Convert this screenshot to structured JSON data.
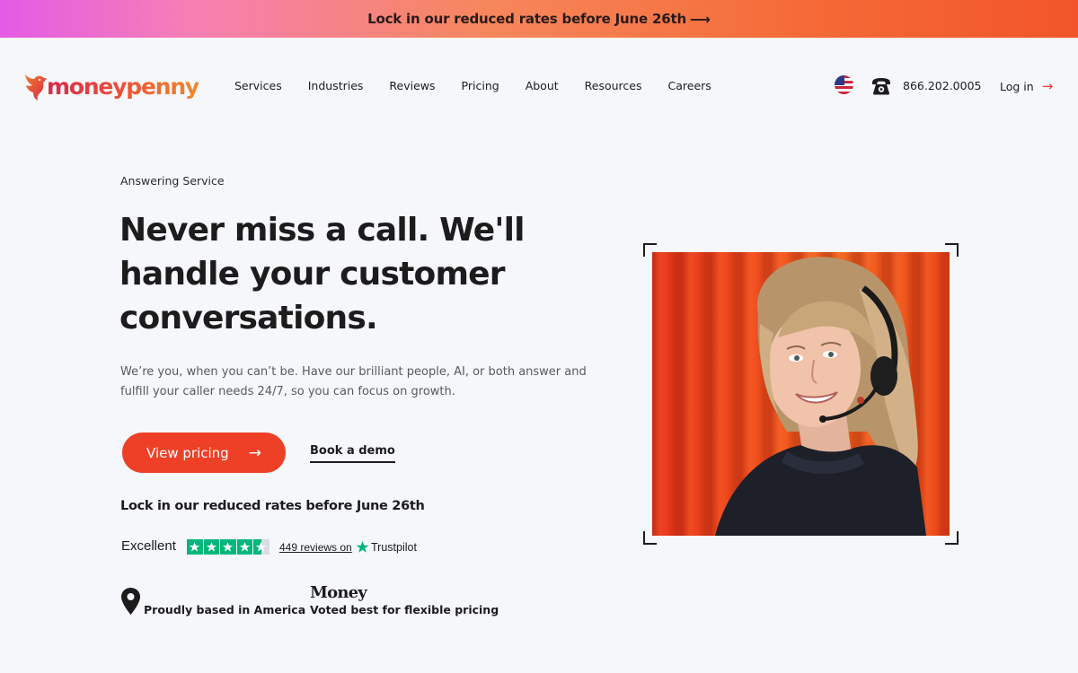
{
  "banner": {
    "text": "Lock in our reduced rates before June 26th",
    "arrow": "⟶"
  },
  "brand": {
    "name": "moneypenny",
    "accent": "#ee4027"
  },
  "nav": {
    "items": [
      {
        "label": "Services"
      },
      {
        "label": "Industries"
      },
      {
        "label": "Reviews"
      },
      {
        "label": "Pricing"
      },
      {
        "label": "About"
      },
      {
        "label": "Resources"
      },
      {
        "label": "Careers"
      }
    ],
    "flag_icon": "us-flag-icon",
    "phone_icon": "telephone-icon",
    "phone": "866.202.0005",
    "login": "Log in",
    "login_arrow": "→"
  },
  "hero": {
    "eyebrow": "Answering Service",
    "headline": "Never miss a call. We'll handle your customer conversations.",
    "subtext": "We’re you, when you can’t be. Have our brilliant people, AI, or both answer and fulfill your caller needs 24/7, so you can focus on growth.",
    "primary_cta": "View pricing",
    "primary_cta_arrow": "→",
    "secondary_cta": "Book a demo",
    "rates_note": "Lock in our reduced rates before June 26th"
  },
  "trustpilot": {
    "rating_word": "Excellent",
    "stars": 4.5,
    "reviews": "449 reviews on",
    "logo": "Trustpilot",
    "star_color": "#00b67a"
  },
  "badges": {
    "location": "Proudly based in America",
    "location_icon": "map-pin-icon",
    "award_logo": "Money",
    "award": "Voted best for flexible pricing"
  }
}
